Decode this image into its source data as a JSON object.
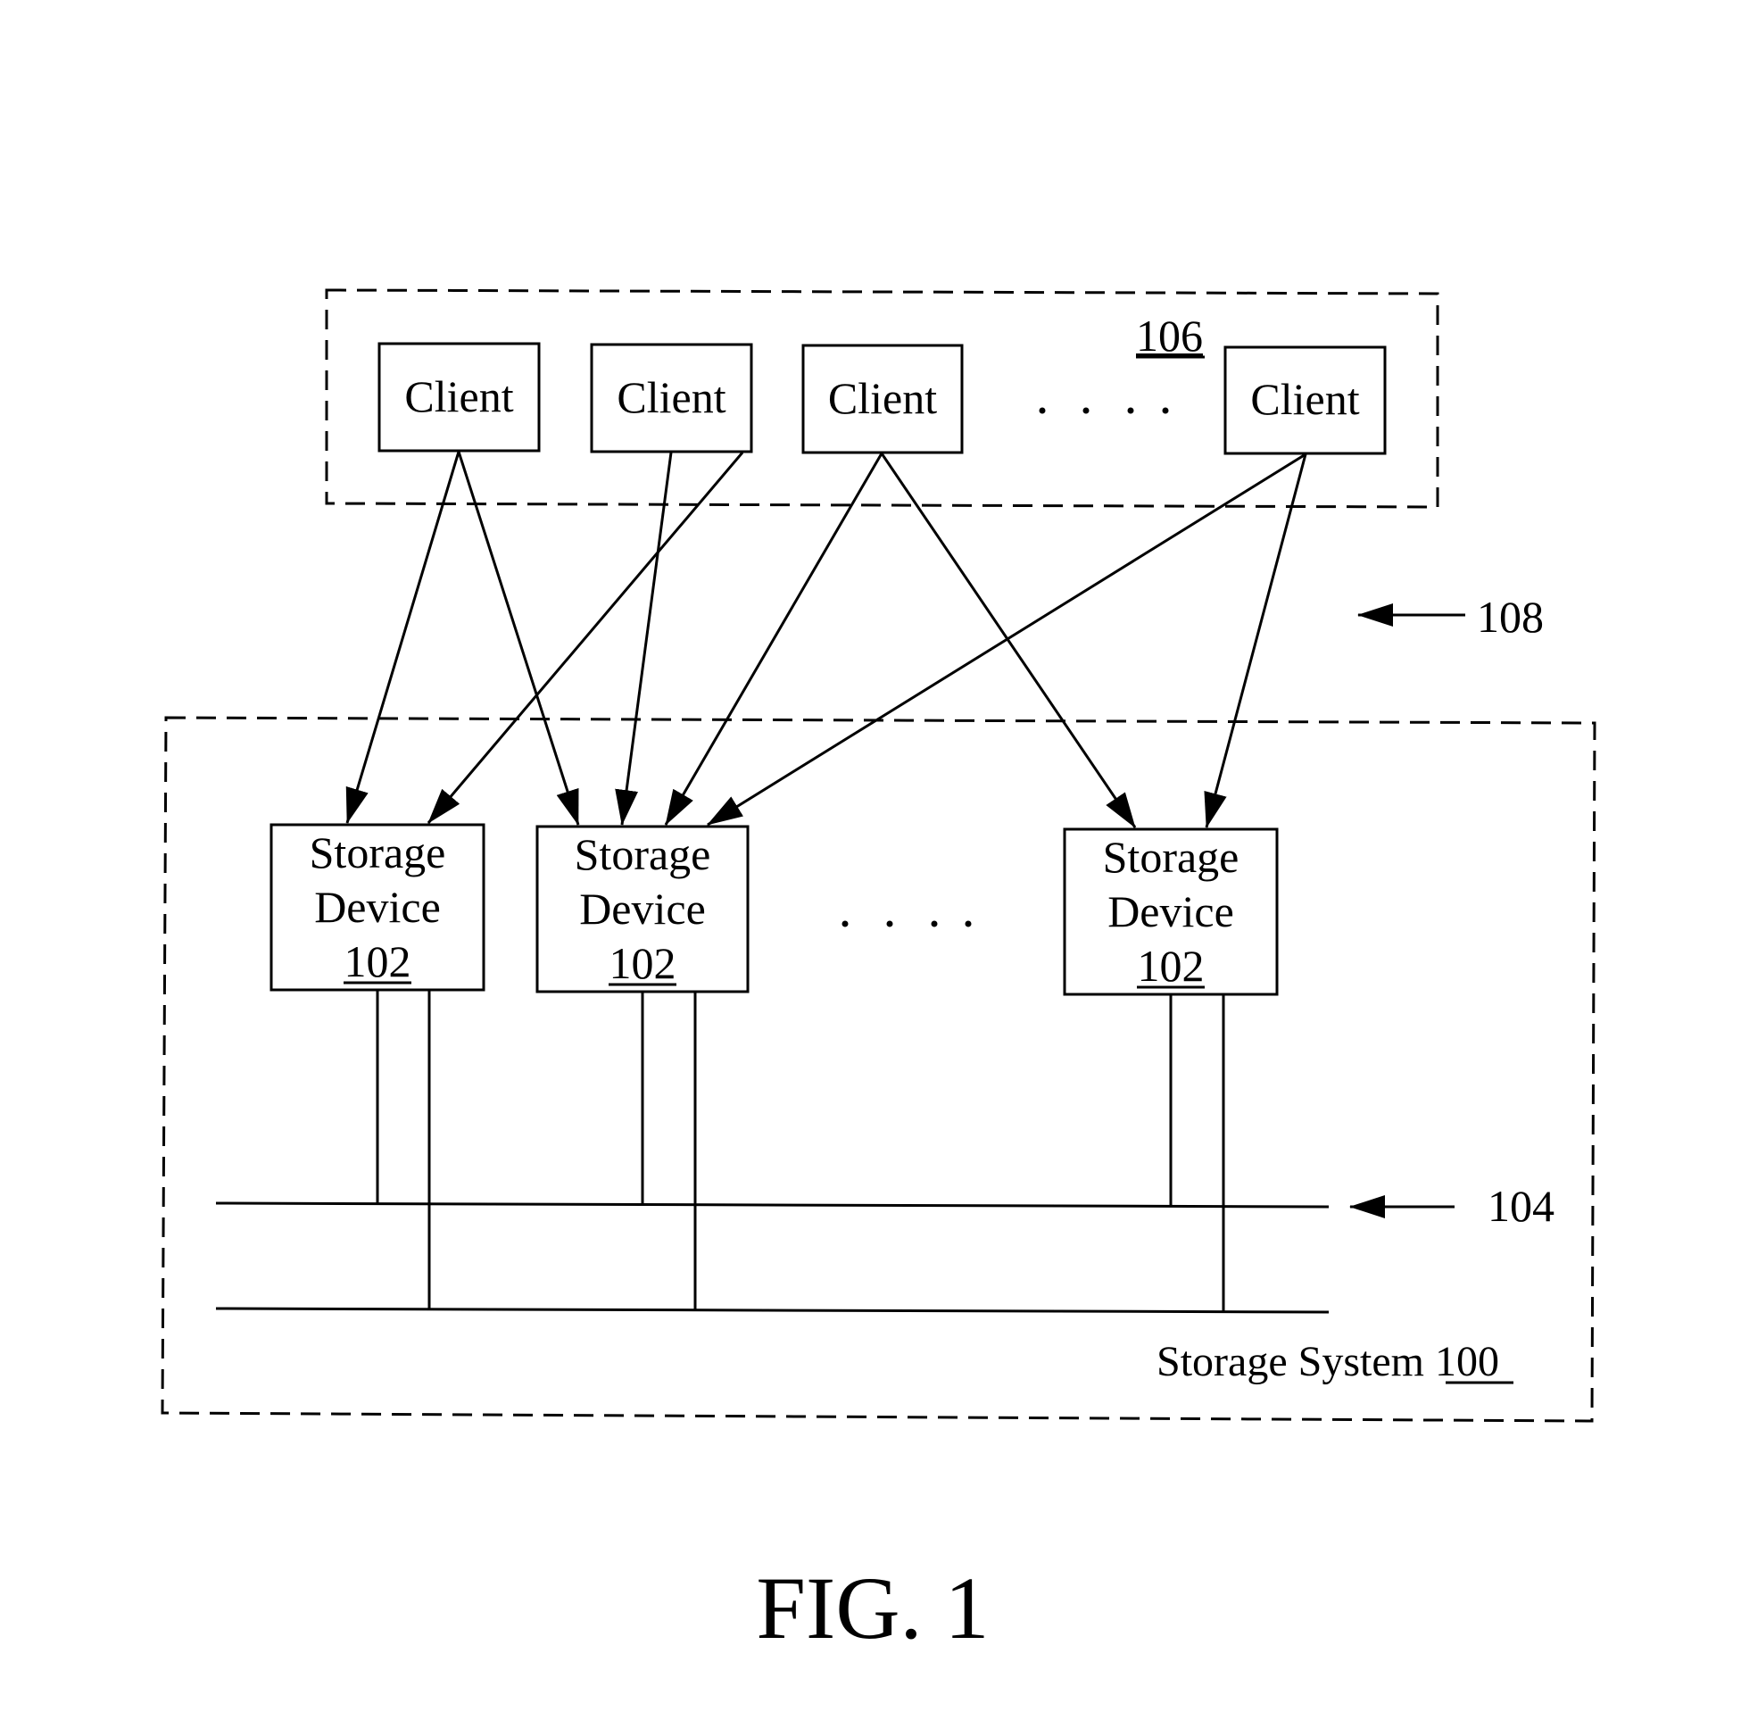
{
  "figure": {
    "caption": "FIG. 1",
    "client_group_ref": "106",
    "network_ref": "108",
    "bus_ref": "104",
    "storage_system_label": "Storage System",
    "storage_system_ref": "100",
    "ellipsis": ". . . .",
    "clients": [
      {
        "label": "Client"
      },
      {
        "label": "Client"
      },
      {
        "label": "Client"
      },
      {
        "label": "Client"
      }
    ],
    "storage_devices": [
      {
        "line1": "Storage",
        "line2": "Device",
        "ref": "102"
      },
      {
        "line1": "Storage",
        "line2": "Device",
        "ref": "102"
      },
      {
        "line1": "Storage",
        "line2": "Device",
        "ref": "102"
      }
    ],
    "connections": [
      {
        "from_client": 0,
        "to_device": 0
      },
      {
        "from_client": 0,
        "to_device": 1
      },
      {
        "from_client": 1,
        "to_device": 1
      },
      {
        "from_client": 1,
        "to_device": 0
      },
      {
        "from_client": 2,
        "to_device": 1
      },
      {
        "from_client": 2,
        "to_device": 2
      },
      {
        "from_client": 3,
        "to_device": 1
      },
      {
        "from_client": 3,
        "to_device": 2
      }
    ],
    "buses": 2
  }
}
